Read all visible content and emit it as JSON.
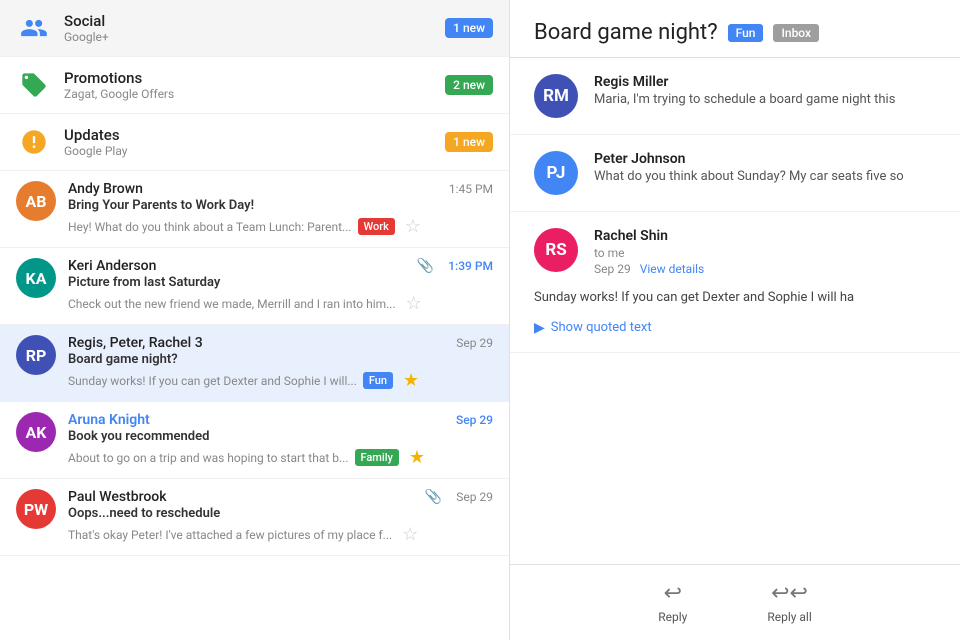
{
  "categories": [
    {
      "id": "social",
      "name": "Social",
      "subtitle": "Google+",
      "badge": "1 new",
      "badge_color": "badge-blue",
      "icon_type": "people",
      "icon_color": "#4285f4"
    },
    {
      "id": "promotions",
      "name": "Promotions",
      "subtitle": "Zagat, Google Offers",
      "badge": "2 new",
      "badge_color": "badge-green",
      "icon_type": "tag",
      "icon_color": "#34a853"
    },
    {
      "id": "updates",
      "name": "Updates",
      "subtitle": "Google Play",
      "badge": "1 new",
      "badge_color": "badge-yellow",
      "icon_type": "info",
      "icon_color": "#f5a623"
    }
  ],
  "emails": [
    {
      "id": "andy",
      "sender": "Andy Brown",
      "time": "1:45 PM",
      "time_blue": false,
      "subject": "Bring Your Parents to Work Day!",
      "preview": "Hey! What do you think about a Team Lunch: Parent...",
      "avatar_initials": "AB",
      "avatar_color": "av-orange",
      "tag": "Work",
      "tag_class": "tag-work",
      "starred": false,
      "clip": false,
      "selected": false
    },
    {
      "id": "keri",
      "sender": "Keri Anderson",
      "time": "1:39 PM",
      "time_blue": false,
      "subject": "Picture from last Saturday",
      "preview": "Check out the new friend we made, Merrill and I ran into him...",
      "avatar_initials": "KA",
      "avatar_color": "av-teal",
      "tag": "",
      "tag_class": "",
      "starred": false,
      "clip": true,
      "selected": false
    },
    {
      "id": "regis",
      "sender": "Regis, Peter, Rachel 3",
      "time": "Sep 29",
      "time_blue": false,
      "subject": "Board game night?",
      "preview": "Sunday works! If you can get Dexter and Sophie I will...",
      "avatar_initials": "RP",
      "avatar_color": "av-indigo",
      "tag": "Fun",
      "tag_class": "tag-fun",
      "starred": true,
      "clip": false,
      "selected": true
    },
    {
      "id": "aruna",
      "sender": "Aruna Knight",
      "time": "Sep 29",
      "time_blue": true,
      "subject": "Book you recommended",
      "preview": "About to go on a trip and was hoping to start that b...",
      "avatar_initials": "AK",
      "avatar_color": "av-purple",
      "tag": "Family",
      "tag_class": "tag-family",
      "starred": true,
      "clip": false,
      "selected": false
    },
    {
      "id": "paul",
      "sender": "Paul Westbrook",
      "time": "Sep 29",
      "time_blue": false,
      "subject": "Oops...need to reschedule",
      "preview": "That's okay Peter! I've attached a few pictures of my place f...",
      "avatar_initials": "PW",
      "avatar_color": "av-red",
      "tag": "",
      "tag_class": "",
      "starred": false,
      "clip": true,
      "selected": false
    }
  ],
  "thread": {
    "title": "Board game night?",
    "tags": [
      {
        "label": "Fun",
        "class": "thread-tag-fun"
      },
      {
        "label": "Inbox",
        "class": "thread-tag-inbox"
      }
    ],
    "messages": [
      {
        "id": "regis-msg",
        "sender": "Regis Miller",
        "preview": "Maria, I'm trying to schedule a board game night this",
        "avatar_initials": "RM",
        "avatar_color": "av-indigo"
      },
      {
        "id": "peter-msg",
        "sender": "Peter Johnson",
        "preview": "What do you think about Sunday? My car seats five so",
        "avatar_initials": "PJ",
        "avatar_color": "av-blue"
      }
    ],
    "rachel": {
      "sender": "Rachel Shin",
      "to": "to me",
      "date": "Sep 29",
      "view_details": "View details",
      "avatar_initials": "RS",
      "avatar_color": "av-pink",
      "body": "Sunday works! If you can get Dexter and Sophie I will ha",
      "show_quoted": "Show quoted text"
    },
    "reply_label": "Reply",
    "reply_all_label": "Reply all"
  }
}
